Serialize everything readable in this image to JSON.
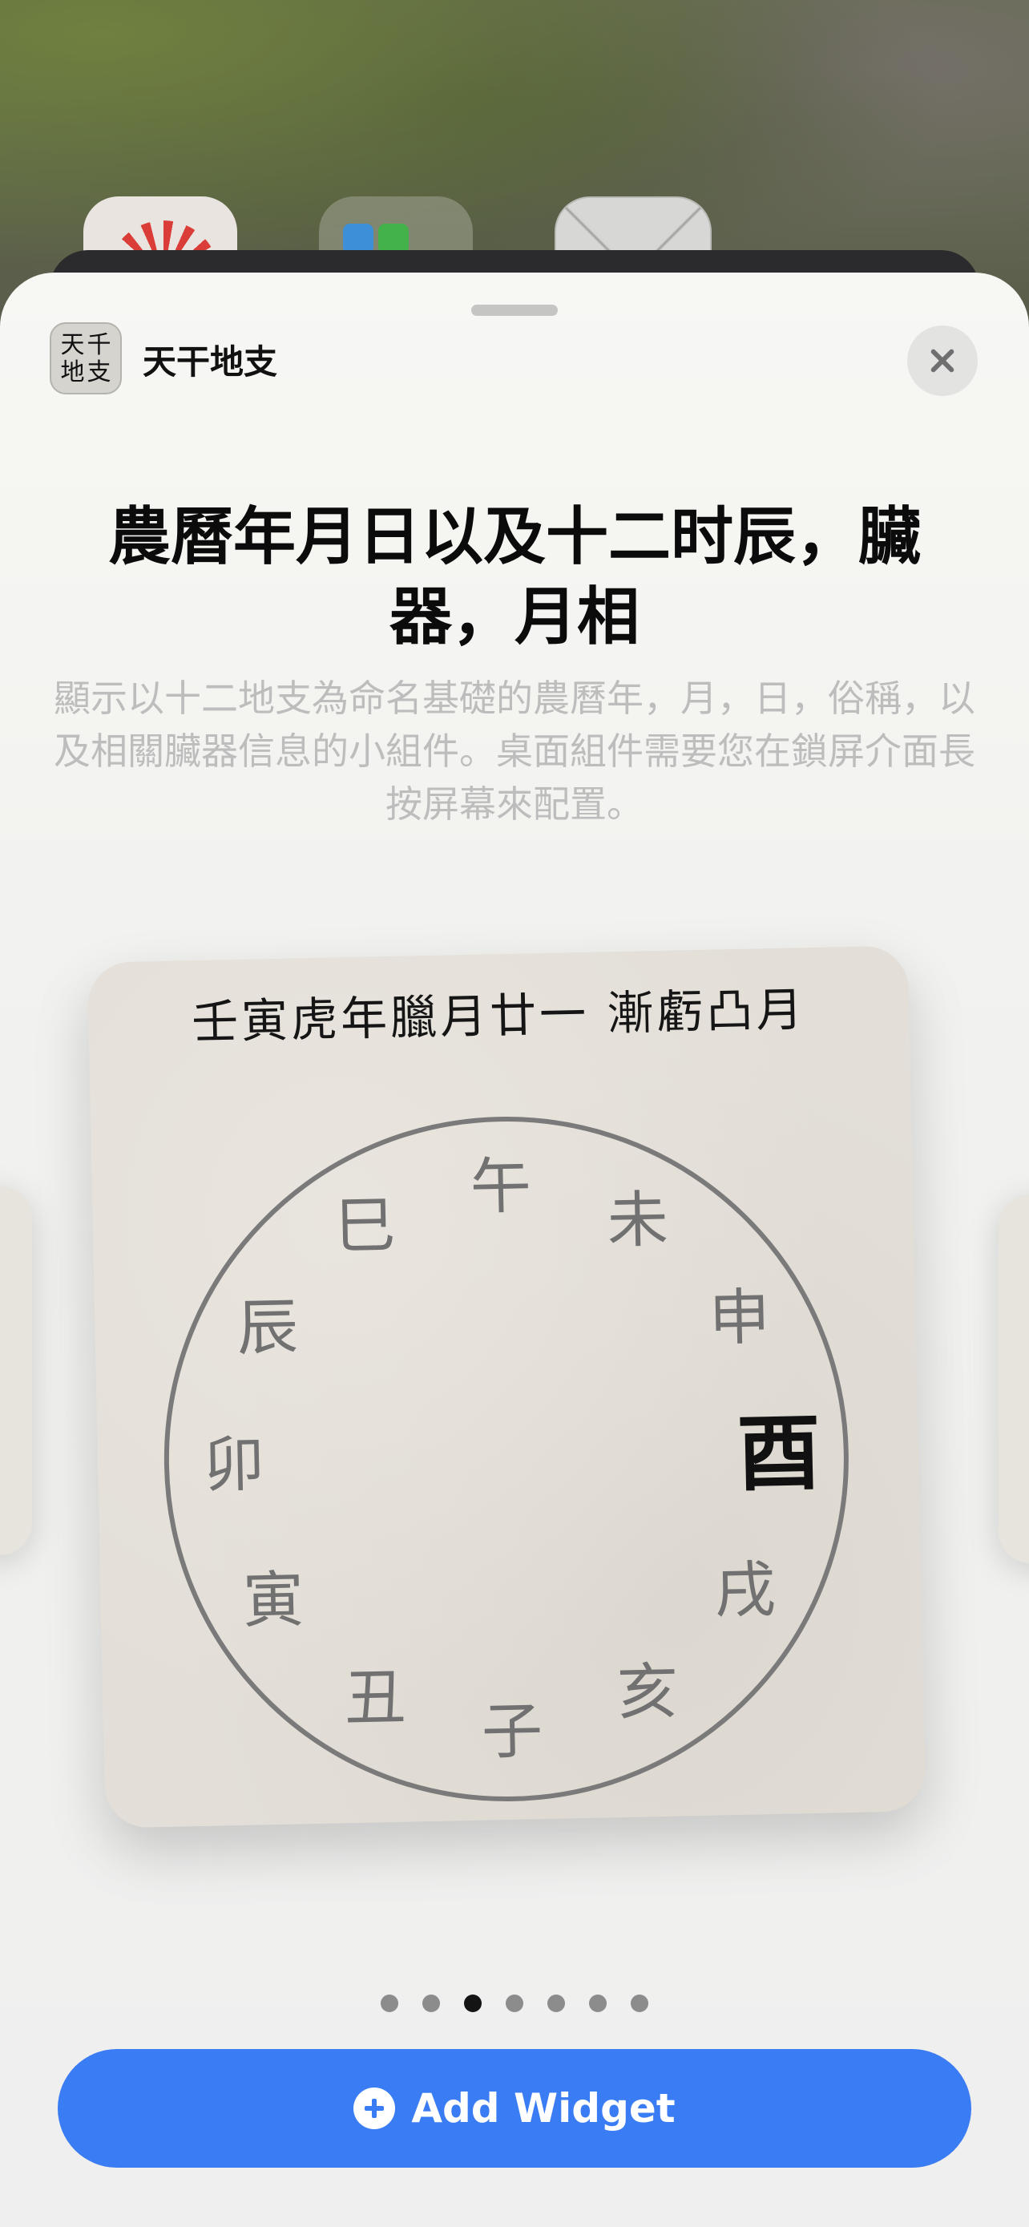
{
  "app": {
    "icon_chars": [
      "天",
      "千",
      "地",
      "支"
    ],
    "name": "天干地支"
  },
  "widget_sheet": {
    "title": "農曆年月日以及十二时辰，臟器，月相",
    "description": "顯示以十二地支為命名基礎的農曆年，月，日，俗稱，以及相關臟器信息的小組件。桌面組件需要您在鎖屏介面長按屏幕來配置。"
  },
  "preview": {
    "header": "壬寅虎年臘月廿一 漸虧凸月",
    "branches": [
      "午",
      "未",
      "申",
      "酉",
      "戌",
      "亥",
      "子",
      "丑",
      "寅",
      "卯",
      "辰",
      "巳"
    ],
    "active_branch": "酉"
  },
  "pager": {
    "count": 7,
    "active_index": 2
  },
  "actions": {
    "add_widget_label": "Add Widget"
  },
  "colors": {
    "accent": "#3a7cf3",
    "active_branch": "#111111",
    "inactive_branch": "#717171"
  }
}
